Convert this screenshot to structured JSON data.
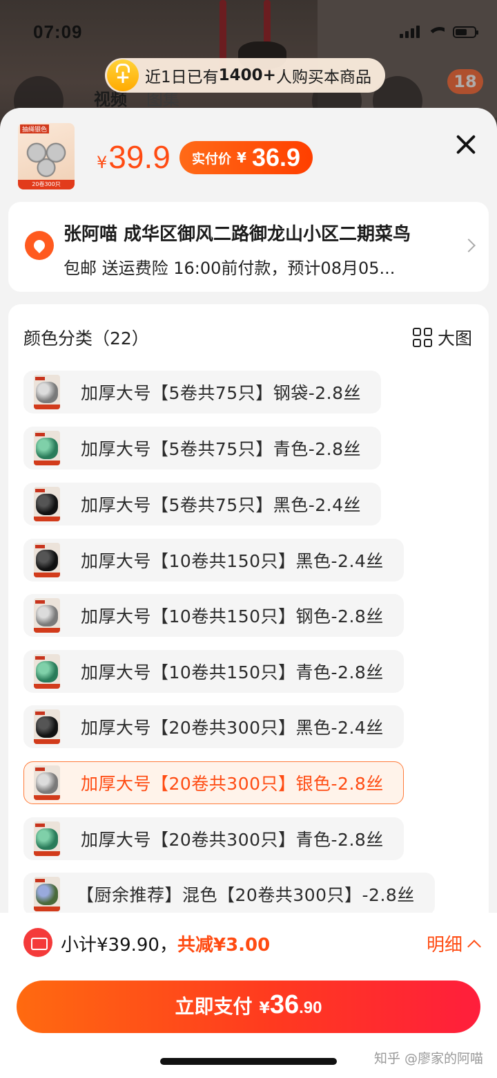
{
  "status_bar": {
    "time": "07:09"
  },
  "background": {
    "tabs": [
      "视频",
      "图集"
    ],
    "cart_count": "18"
  },
  "banner": {
    "pre": "近1日已有",
    "count": "1400+",
    "post": "人购买本商品",
    "icon_char": "+"
  },
  "product": {
    "thumb_tag": "抽绳银色",
    "thumb_strip": "20卷300只",
    "price_symbol": "¥",
    "price": "39.9",
    "pay_label": "实付价",
    "pay_symbol": "¥",
    "pay_price": "36.9"
  },
  "address": {
    "line1": "张阿喵 成华区御风二路御龙山小区二期菜鸟",
    "line2": "包邮 送运费险 16:00前付款，预计08月05..."
  },
  "options": {
    "title": "颜色分类（22）",
    "big_view": "大图",
    "items": [
      {
        "label": "加厚大号【5卷共75只】钢袋-2.8丝",
        "color": "silver"
      },
      {
        "label": "加厚大号【5卷共75只】青色-2.8丝",
        "color": "green"
      },
      {
        "label": "加厚大号【5卷共75只】黑色-2.4丝",
        "color": "black"
      },
      {
        "label": "加厚大号【10卷共150只】黑色-2.4丝",
        "color": "black"
      },
      {
        "label": "加厚大号【10卷共150只】钢色-2.8丝",
        "color": "silver"
      },
      {
        "label": "加厚大号【10卷共150只】青色-2.8丝",
        "color": "green"
      },
      {
        "label": "加厚大号【20卷共300只】黑色-2.4丝",
        "color": "black"
      },
      {
        "label": "加厚大号【20卷共300只】银色-2.8丝",
        "color": "silver",
        "selected": true
      },
      {
        "label": "加厚大号【20卷共300只】青色-2.8丝",
        "color": "green"
      },
      {
        "label": "【厨余推荐】混色【20卷共300只】-2.8丝",
        "color": "mixed"
      }
    ]
  },
  "footer": {
    "subtotal": "小计¥39.90，",
    "discount": "共减¥3.00",
    "detail": "明细",
    "pay_label": "立即支付",
    "pay_symbol": "¥",
    "pay_int": "36",
    "pay_dec": ".90",
    "watermark": "知乎 @廖家的阿喵"
  },
  "colors": {
    "accent": "#ff4b12",
    "selected_bg": "#fff3ea"
  }
}
